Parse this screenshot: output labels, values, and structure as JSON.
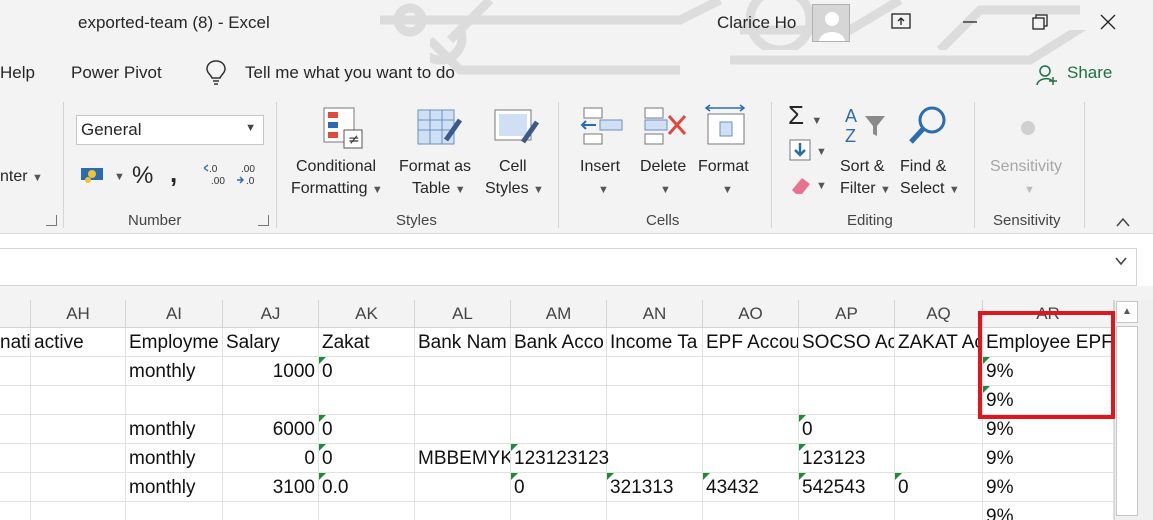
{
  "window": {
    "title": "exported-team (8)  -  Excel",
    "user": "Clarice Ho"
  },
  "menu": {
    "items": [
      "Help",
      "Power Pivot"
    ],
    "tell_me": "Tell me what you want to do",
    "share": "Share"
  },
  "ribbon": {
    "partial_label": "nter",
    "number_format": "General",
    "percent_symbol": "%",
    "comma_symbol": ",",
    "groups": {
      "number": "Number",
      "styles": "Styles",
      "cells": "Cells",
      "editing": "Editing",
      "sensitivity": "Sensitivity"
    },
    "styles_buttons": [
      {
        "line1": "Conditional",
        "line2": "Formatting"
      },
      {
        "line1": "Format as",
        "line2": "Table"
      },
      {
        "line1": "Cell",
        "line2": "Styles"
      }
    ],
    "cells_buttons": [
      "Insert",
      "Delete",
      "Format"
    ],
    "editing_buttons": [
      {
        "line1": "Sort &",
        "line2": "Filter"
      },
      {
        "line1": "Find &",
        "line2": "Select"
      }
    ],
    "sensitivity_button": "Sensitivity"
  },
  "grid": {
    "columns": [
      "",
      "AH",
      "AI",
      "AJ",
      "AK",
      "AL",
      "AM",
      "AN",
      "AO",
      "AP",
      "AQ",
      "AR"
    ],
    "rows": [
      [
        "natio",
        "active",
        "Employme",
        "Salary",
        "Zakat",
        "Bank Nam",
        "Bank Acco",
        "Income Ta",
        "EPF Accou",
        "SOCSO Ac",
        "ZAKAT Ac",
        "Employee EPF"
      ],
      [
        "",
        "",
        "monthly",
        "1000",
        "0",
        "",
        "",
        "",
        "",
        "",
        "",
        "9%"
      ],
      [
        "",
        "",
        "",
        "",
        "",
        "",
        "",
        "",
        "",
        "",
        "",
        "9%"
      ],
      [
        "",
        "",
        "monthly",
        "6000",
        "0",
        "",
        "",
        "",
        "",
        "0",
        "",
        "9%"
      ],
      [
        "",
        "",
        "monthly",
        "0",
        "0",
        "MBBEMYKL",
        "123123123",
        "",
        "",
        "123123",
        "",
        "9%"
      ],
      [
        "",
        "",
        "monthly",
        "3100",
        "0.0",
        "",
        "0",
        "321313",
        "43432",
        "542543",
        "0",
        "9%"
      ],
      [
        "",
        "",
        "",
        "",
        "",
        "",
        "",
        "",
        "",
        "",
        "",
        "9%"
      ]
    ]
  }
}
